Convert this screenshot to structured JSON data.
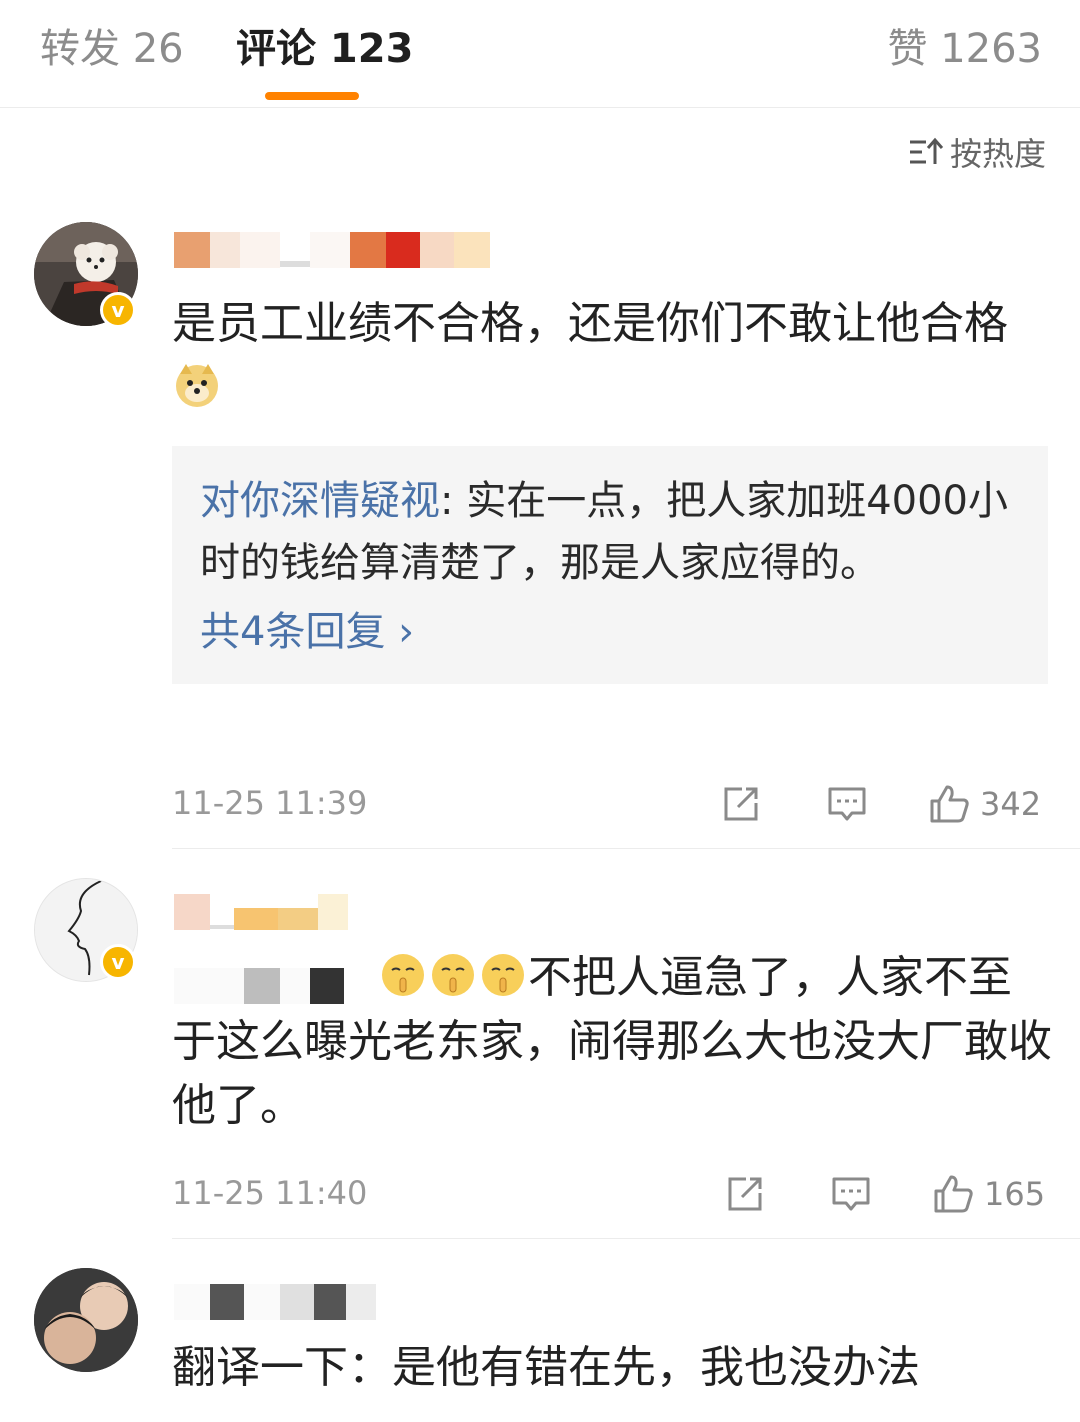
{
  "tabs": {
    "repost": "转发 26",
    "comment": "评论 123",
    "like": "赞 1263"
  },
  "sort": {
    "label": "按热度"
  },
  "comments": [
    {
      "text": "是员工业绩不合格，还是你们不敢让他合格",
      "reply": {
        "user": "对你深情疑视",
        "text": ": 实在一点，把人家加班4000小时的钱给算清楚了，那是人家应得的。",
        "more": "共4条回复 ›"
      },
      "time": "11-25 11:39",
      "likes": "342"
    },
    {
      "text": "不把人逼急了，人家不至于这么曝光老东家，闹得那么大也没大厂敢收他了。",
      "time": "11-25 11:40",
      "likes": "165"
    },
    {
      "text": "翻译一下：是他有错在先，我也没办法"
    }
  ],
  "colors": {
    "accent": "#ff8200",
    "link": "#4a72a8",
    "verified": "#f7b500"
  }
}
